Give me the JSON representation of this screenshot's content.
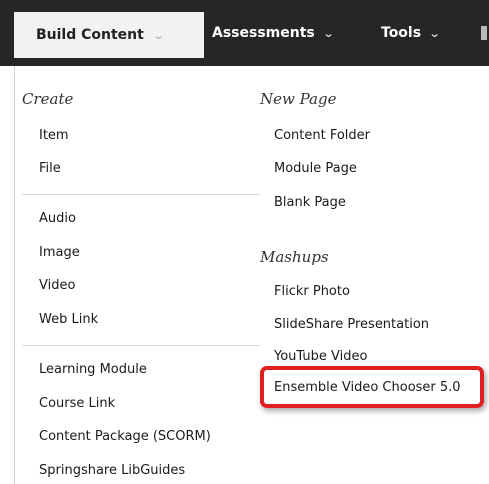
{
  "toolbar": {
    "build_content": "Build Content",
    "assessments": "Assessments",
    "tools": "Tools",
    "chevron": "⌄"
  },
  "create": {
    "heading": "Create",
    "items": [
      "Item",
      "File",
      "Audio",
      "Image",
      "Video",
      "Web Link",
      "Learning Module",
      "Course Link",
      "Content Package (SCORM)",
      "Springshare LibGuides"
    ]
  },
  "new_page": {
    "heading": "New Page",
    "items": [
      "Content Folder",
      "Module Page",
      "Blank Page"
    ]
  },
  "mashups": {
    "heading": "Mashups",
    "items": [
      "Flickr Photo",
      "SlideShare Presentation",
      "YouTube Video",
      "Ensemble Video Chooser 5.0"
    ]
  },
  "colors": {
    "toolbar_bg": "#262626",
    "active_tab_bg": "#f2f2f2",
    "highlight_border": "#e02020"
  }
}
